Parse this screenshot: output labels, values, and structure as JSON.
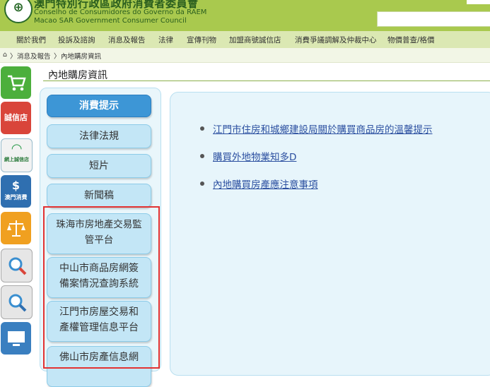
{
  "header": {
    "title_zh": "澳門特別行政區政府消費者委員會",
    "title_pt": "Conselho de Consumidores do Governo da RAEM",
    "title_en": "Macao SAR Government Consumer Council"
  },
  "nav": [
    "關於我們",
    "投訴及諮詢",
    "消息及報告",
    "法律",
    "宣傳刊物",
    "加盟商號誠信店",
    "消費爭議調解及仲裁中心",
    "物價普查/格價"
  ],
  "breadcrumb": [
    "消息及報告",
    "內地購房資訊"
  ],
  "rail": [
    "誠信店",
    "網上誠信店",
    "澳門消費"
  ],
  "page_title": "內地購房資訊",
  "subnav": [
    {
      "label": "消費提示"
    },
    {
      "label": "法律法規"
    },
    {
      "label": "短片"
    },
    {
      "label": "新聞稿"
    },
    {
      "line1": "珠海市房地產交易監",
      "line2": "管平台"
    },
    {
      "line1": "中山市商品房網簽",
      "line2": "備案情況查詢系統"
    },
    {
      "line1": "江門市房屋交易和",
      "line2": "產權管理信息平台"
    },
    {
      "line1": "佛山市房產信息網",
      "line2": ""
    }
  ],
  "links": [
    "江門市住房和城鄉建設局關於購買商品房的溫馨提示",
    "購買外地物業知多D",
    "內地購買房產應注意事項"
  ],
  "colors": {
    "header_green": "#a9c94e",
    "nav_green": "#dbe8b3",
    "button_blue": "#c3e6f6",
    "active_blue": "#3d96d6",
    "highlight_red": "#e23232",
    "link_blue": "#2b4fa0"
  }
}
